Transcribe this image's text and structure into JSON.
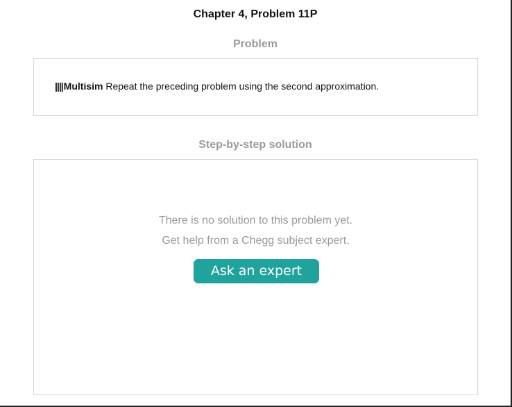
{
  "page": {
    "title": "Chapter 4, Problem 11P"
  },
  "problem": {
    "heading": "Problem",
    "marker": "||||",
    "tag": "Multisim",
    "text": " Repeat the preceding problem using the second approximation."
  },
  "solution": {
    "heading": "Step-by-step solution",
    "empty_line_1": "There is no solution to this problem yet.",
    "empty_line_2": "Get help from a Chegg subject expert.",
    "ask_button_label": "Ask an expert"
  },
  "colors": {
    "accent": "#20a39c",
    "heading_gray": "#9a9a9a",
    "panel_border": "#d6d6d6"
  }
}
